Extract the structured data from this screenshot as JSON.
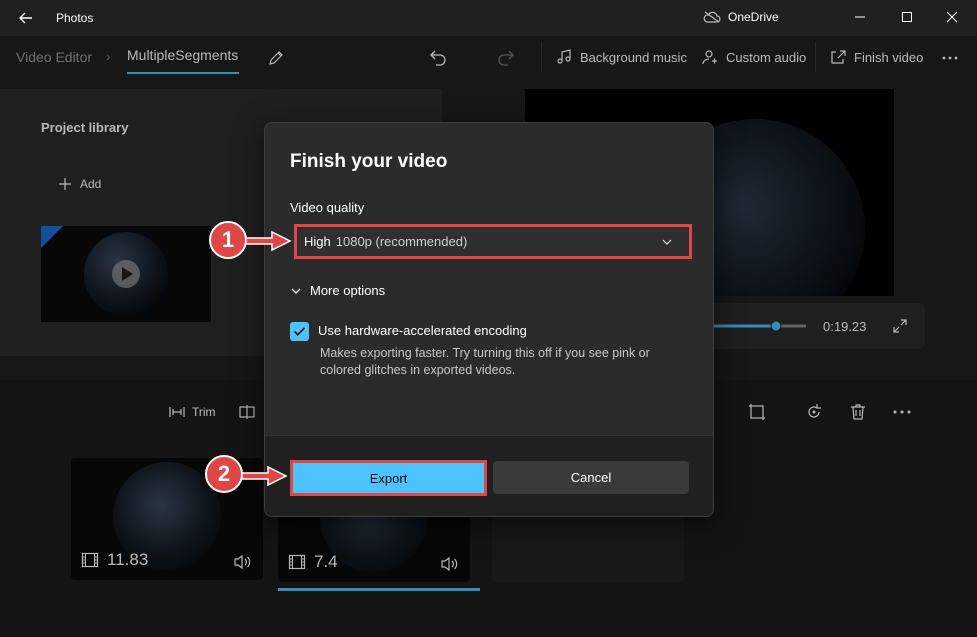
{
  "app": {
    "title": "Photos",
    "onedrive_label": "OneDrive"
  },
  "breadcrumb": {
    "root": "Video Editor",
    "separator": "›",
    "current": "MultipleSegments"
  },
  "toolbar": {
    "background_music": "Background music",
    "custom_audio": "Custom audio",
    "finish_video": "Finish video"
  },
  "library": {
    "title": "Project library",
    "add_label": "Add"
  },
  "preview": {
    "timecode": "0:19.23"
  },
  "storyboard": {
    "trim_label": "Trim",
    "clips": [
      {
        "duration": "11.83"
      },
      {
        "duration": "7.4"
      }
    ]
  },
  "dialog": {
    "title": "Finish your video",
    "quality_label": "Video quality",
    "quality_value_main": "High",
    "quality_value_detail": "1080p (recommended)",
    "more_options": "More options",
    "hw_encoding_label": "Use hardware-accelerated encoding",
    "hw_encoding_checked": true,
    "hw_encoding_desc": "Makes exporting faster. Try turning this off if you see pink or colored glitches in exported videos.",
    "export_label": "Export",
    "cancel_label": "Cancel"
  },
  "annotations": {
    "step1": "1",
    "step2": "2"
  },
  "colors": {
    "accent": "#4cc2ff",
    "highlight": "#e04646",
    "background": "#202020",
    "panel": "#2b2b2b"
  },
  "icons": [
    "back-arrow-icon",
    "onedrive-icon",
    "minimize-icon",
    "maximize-icon",
    "close-icon",
    "pencil-icon",
    "undo-icon",
    "redo-icon",
    "music-note-icon",
    "custom-audio-icon",
    "share-icon",
    "more-icon",
    "plus-icon",
    "play-icon",
    "volume-icon",
    "fullscreen-icon",
    "trim-icon",
    "split-icon",
    "crop-icon",
    "rotate-icon",
    "delete-icon",
    "film-icon",
    "chevron-down-icon",
    "checkmark-icon"
  ]
}
